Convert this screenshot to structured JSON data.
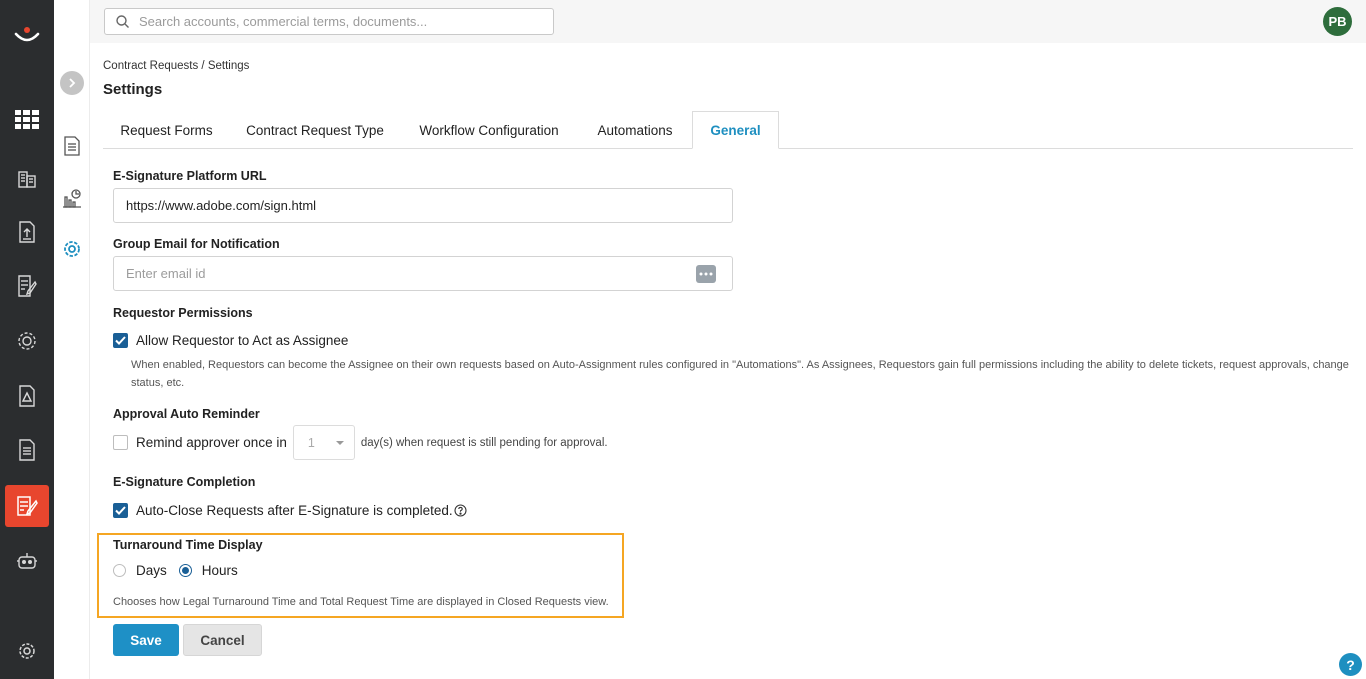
{
  "topbar": {
    "search_placeholder": "Search accounts, commercial terms, documents...",
    "avatar_initials": "PB"
  },
  "breadcrumb": "Contract Requests / Settings",
  "page_title": "Settings",
  "tabs": [
    {
      "label": "Request Forms"
    },
    {
      "label": "Contract Request Type"
    },
    {
      "label": "Workflow Configuration"
    },
    {
      "label": "Automations"
    },
    {
      "label": "General",
      "active": true
    }
  ],
  "esign_url": {
    "label": "E-Signature Platform URL",
    "value": "https://www.adobe.com/sign.html"
  },
  "group_email": {
    "label": "Group Email for Notification",
    "placeholder": "Enter email id"
  },
  "requestor_permissions": {
    "label": "Requestor Permissions",
    "checkbox_label": "Allow Requestor to Act as Assignee",
    "checked": true,
    "description": "When enabled, Requestors can become the Assignee on their own requests based on Auto-Assignment rules configured in \"Automations\". As Assignees, Requestors gain full permissions including the ability to delete tickets, request approvals, change status, etc."
  },
  "approval_reminder": {
    "label": "Approval Auto Reminder",
    "checkbox_label": "Remind approver once in",
    "checked": false,
    "days_value": "1",
    "after_text": "day(s) when request is still pending for approval."
  },
  "esign_completion": {
    "label": "E-Signature Completion",
    "checkbox_label": "Auto-Close Requests after E-Signature is completed.",
    "checked": true
  },
  "turnaround": {
    "label": "Turnaround Time Display",
    "options": [
      {
        "label": "Days",
        "selected": false
      },
      {
        "label": "Hours",
        "selected": true
      }
    ],
    "description": "Chooses how Legal Turnaround Time and Total Request Time are displayed in Closed Requests view."
  },
  "buttons": {
    "save": "Save",
    "cancel": "Cancel"
  },
  "help_label": "?",
  "colors": {
    "accent": "#1e8fc0",
    "rail": "#2b2d2f",
    "active_rail": "#e8462e",
    "highlight": "#f5a623"
  }
}
